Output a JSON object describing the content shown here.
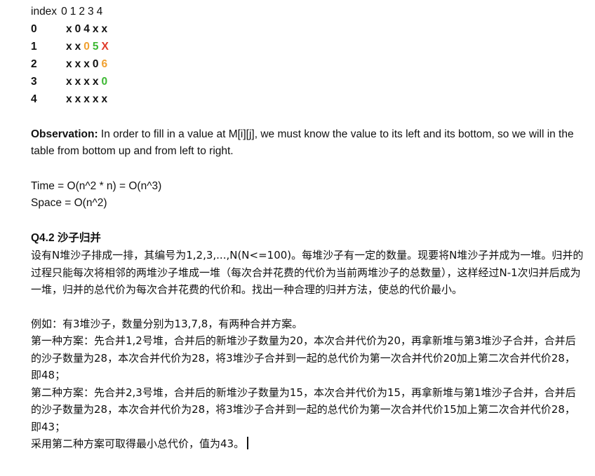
{
  "table": {
    "header_label": "index",
    "header_cols": [
      "0",
      "1",
      "2",
      "3",
      "4"
    ],
    "rows": [
      {
        "index": "0",
        "cells": [
          {
            "v": "x"
          },
          {
            "v": "0"
          },
          {
            "v": "4"
          },
          {
            "v": "x"
          },
          {
            "v": "x"
          }
        ]
      },
      {
        "index": "1",
        "cells": [
          {
            "v": "x"
          },
          {
            "v": "x"
          },
          {
            "v": "0"
          },
          {
            "v": "5"
          },
          {
            "v": "X"
          }
        ]
      },
      {
        "index": "2",
        "cells": [
          {
            "v": "x"
          },
          {
            "v": "x"
          },
          {
            "v": "x"
          },
          {
            "v": "0"
          },
          {
            "v": "6"
          }
        ]
      },
      {
        "index": "3",
        "cells": [
          {
            "v": "x"
          },
          {
            "v": "x"
          },
          {
            "v": "x"
          },
          {
            "v": "x"
          },
          {
            "v": "0"
          }
        ]
      },
      {
        "index": "4",
        "cells": [
          {
            "v": "x"
          },
          {
            "v": "x"
          },
          {
            "v": "x"
          },
          {
            "v": "x"
          },
          {
            "v": "x"
          }
        ]
      }
    ],
    "colors": {
      "orange": "#f0a030",
      "green": "#3cb832",
      "red": "#e03a2a"
    }
  },
  "observation": {
    "label": "Observation:",
    "text": " In order to fill in a value at M[i][j], we must know the value to its left and its bottom, so we will in the table from bottom up and from left to right."
  },
  "complexity": {
    "time": "Time = O(n^2 * n) = O(n^3)",
    "space": "Space = O(n^2)"
  },
  "question": {
    "title": "Q4.2 沙子归并",
    "body": "设有N堆沙子排成一排，其编号为1,2,3,...,N(N<=100)。每堆沙子有一定的数量。现要将N堆沙子并成为一堆。归并的过程只能每次将相邻的两堆沙子堆成一堆（每次合并花费的代价为当前两堆沙子的总数量），这样经过N-1次归并后成为一堆，归并的总代价为每次合并花费的代价和。找出一种合理的归并方法，使总的代价最小。"
  },
  "example": {
    "intro": "例如：有3堆沙子，数量分别为13,7,8，有两种合并方案。",
    "plan1": "第一种方案：先合并1,2号堆，合并后的新堆沙子数量为20，本次合并代价为20，再拿新堆与第3堆沙子合并，合并后的沙子数量为28，本次合并代价为28，将3堆沙子合并到一起的总代价为第一次合并代价20加上第二次合并代价28，即48；",
    "plan2": "第二种方案：先合并2,3号堆，合并后的新堆沙子数量为15，本次合并代价为15，再拿新堆与第1堆沙子合并，合并后的沙子数量为28，本次合并代价为28，将3堆沙子合并到一起的总代价为第一次合并代价15加上第二次合并代价28，即43；",
    "conclusion": "采用第二种方案可取得最小总代价，值为43。"
  }
}
